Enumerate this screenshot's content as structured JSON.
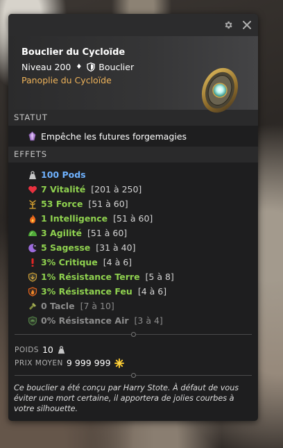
{
  "item": {
    "name": "Bouclier du Cycloïde",
    "level": "Niveau 200",
    "type": "Bouclier",
    "set": "Panoplie du Cycloïde",
    "icon": "shield-item-icon"
  },
  "sections": {
    "status": "STATUT",
    "effects": "EFFETS"
  },
  "status": {
    "text": "Empêche les futures forgemagies",
    "icon": "purple-gem-icon"
  },
  "effects": [
    {
      "icon": "weight-icon",
      "main": "100 Pods",
      "range": "",
      "color": "#6fb2ff"
    },
    {
      "icon": "heart-icon",
      "main": "7 Vitalité",
      "range": "[201 à 250]",
      "color": "#8fd14f"
    },
    {
      "icon": "strength-icon",
      "main": "53 Force",
      "range": "[51 à 60]",
      "color": "#8fd14f"
    },
    {
      "icon": "fire-icon",
      "main": "1 Intelligence",
      "range": "[51 à 60]",
      "color": "#8fd14f"
    },
    {
      "icon": "agility-icon",
      "main": "3 Agilité",
      "range": "[51 à 60]",
      "color": "#8fd14f"
    },
    {
      "icon": "wisdom-icon",
      "main": "5 Sagesse",
      "range": "[31 à 40]",
      "color": "#8fd14f"
    },
    {
      "icon": "critical-icon",
      "main": "3% Critique",
      "range": "[4 à 6]",
      "color": "#8fd14f"
    },
    {
      "icon": "earth-resistance-icon",
      "main": "1% Résistance Terre",
      "range": "[5 à 8]",
      "color": "#8fd14f"
    },
    {
      "icon": "fire-resistance-icon",
      "main": "3% Résistance Feu",
      "range": "[4 à 6]",
      "color": "#8fd14f"
    },
    {
      "icon": "tackle-icon",
      "main": "0 Tacle",
      "range": "[7 à 10]",
      "color": "#8d8d8d"
    },
    {
      "icon": "air-resistance-icon",
      "main": "0% Résistance Air",
      "range": "[3 à 4]",
      "color": "#8d8d8d"
    }
  ],
  "properties": {
    "weight_label": "POIDS",
    "weight_value": "10",
    "price_label": "PRIX MOYEN",
    "price_value": "9 999 999"
  },
  "description": "Ce bouclier a été conçu par Harry Stote. À défaut de vous éviter une mort certaine, il apportera de jolies courbes à votre silhouette."
}
